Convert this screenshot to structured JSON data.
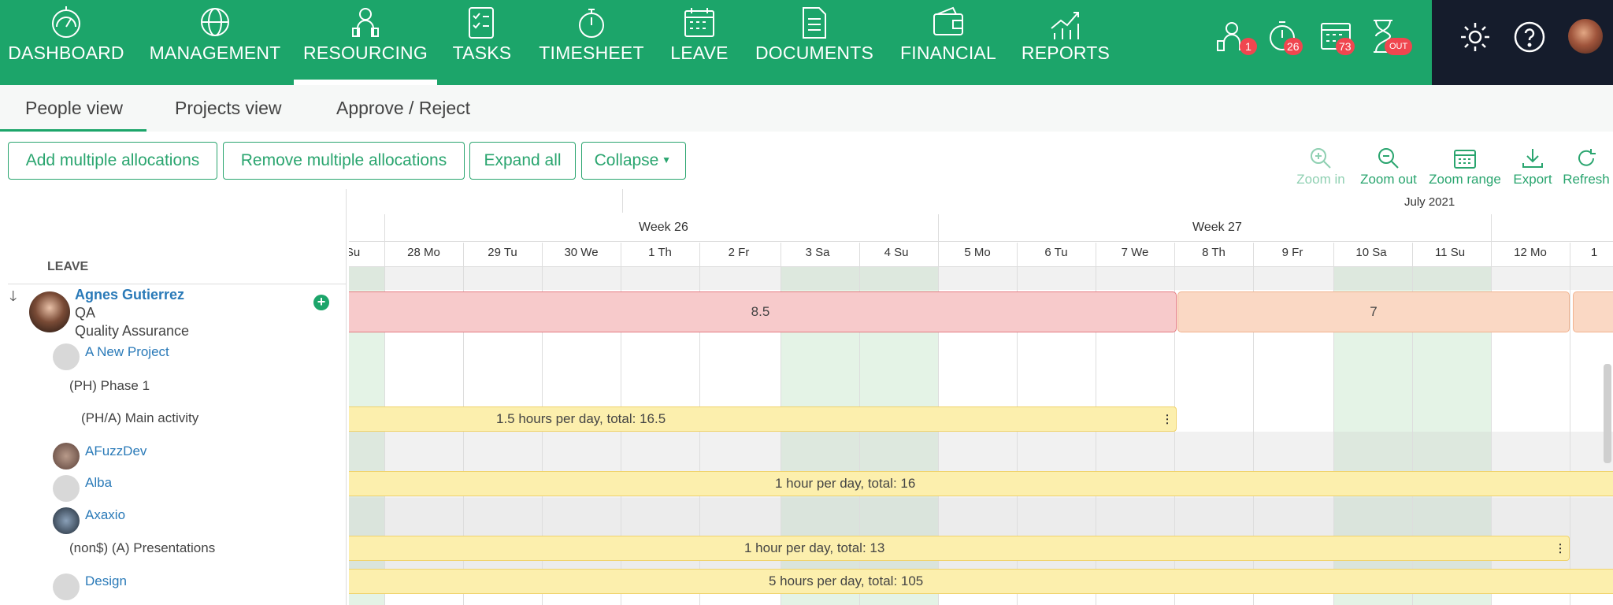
{
  "nav": {
    "items": [
      {
        "label": "DASHBOARD",
        "icon": "dashboard-gauge-icon"
      },
      {
        "label": "MANAGEMENT",
        "icon": "globe-icon"
      },
      {
        "label": "RESOURCING",
        "icon": "resourcing-people-icon"
      },
      {
        "label": "TASKS",
        "icon": "tasks-checklist-icon"
      },
      {
        "label": "TIMESHEET",
        "icon": "stopwatch-icon"
      },
      {
        "label": "LEAVE",
        "icon": "calendar-icon"
      },
      {
        "label": "DOCUMENTS",
        "icon": "document-icon"
      },
      {
        "label": "FINANCIAL",
        "icon": "wallet-icon"
      },
      {
        "label": "REPORTS",
        "icon": "chart-growth-icon"
      }
    ],
    "active": "RESOURCING",
    "badges": {
      "resourcing": "1",
      "timesheet": "26",
      "leave": "73",
      "hourglass": "OUT"
    },
    "colors": {
      "primary": "#1ca56a",
      "dark": "#151c2c",
      "badge": "#f0464f"
    }
  },
  "tabs": [
    "People view",
    "Projects view",
    "Approve / Reject"
  ],
  "toolbar": {
    "add": "Add multiple allocations",
    "remove": "Remove multiple allocations",
    "expand": "Expand all",
    "collapse": "Collapse",
    "zoom_in": "Zoom in",
    "zoom_out": "Zoom out",
    "zoom_range": "Zoom range",
    "export": "Export",
    "refresh": "Refresh"
  },
  "calendar": {
    "month": "July 2021",
    "weeks": [
      "Week 26",
      "Week 27"
    ],
    "days": [
      "Su",
      "28 Mo",
      "29 Tu",
      "30 We",
      "1 Th",
      "2 Fr",
      "3 Sa",
      "4 Su",
      "5 Mo",
      "6 Tu",
      "7 We",
      "8 Th",
      "9 Fr",
      "10 Sa",
      "11 Su",
      "12 Mo",
      "1"
    ]
  },
  "left": {
    "section": "LEAVE",
    "person": {
      "name": "Agnes Gutierrez",
      "role": "QA",
      "dept": "Quality Assurance"
    },
    "rows": [
      "A New Project",
      "(PH) Phase 1",
      "(PH/A) Main activity",
      "AFuzzDev",
      "Alba",
      "Axaxio",
      "(non$) (A) Presentations",
      "Design"
    ]
  },
  "bars": {
    "leave_a": "8.5",
    "leave_b": "7",
    "b1": "1.5 hours per day, total: 16.5",
    "b2": "1 hour per day, total: 16",
    "b3": "1 hour per day, total: 13",
    "b4": "5 hours per day, total: 105"
  }
}
